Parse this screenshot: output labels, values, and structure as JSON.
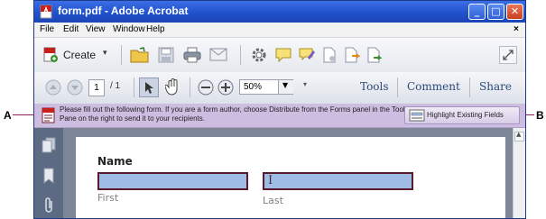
{
  "window": {
    "title": "form.pdf - Adobe Acrobat"
  },
  "menu": [
    "File",
    "Edit",
    "View",
    "Window",
    "Help"
  ],
  "toolbar": {
    "create_label": "Create",
    "page_current": "1",
    "page_total": "/ 1",
    "zoom_value": "50%",
    "tools_label": "Tools",
    "comment_label": "Comment",
    "share_label": "Share"
  },
  "infobar": {
    "message": "Please fill out the following form. If you are a form author, choose Distribute from the Forms panel in the Tools Pane on the right to send it to your recipients.",
    "highlight_label": "Highlight Existing Fields"
  },
  "form": {
    "section_title": "Name",
    "first_label": "First",
    "last_label": "Last"
  },
  "callouts": {
    "a": "A",
    "b": "B"
  },
  "colors": {
    "titlebar": "#2454d0",
    "infobar": "#cdbde1",
    "field_fill": "#9fbce6",
    "callout_line": "#8c1d5a"
  }
}
